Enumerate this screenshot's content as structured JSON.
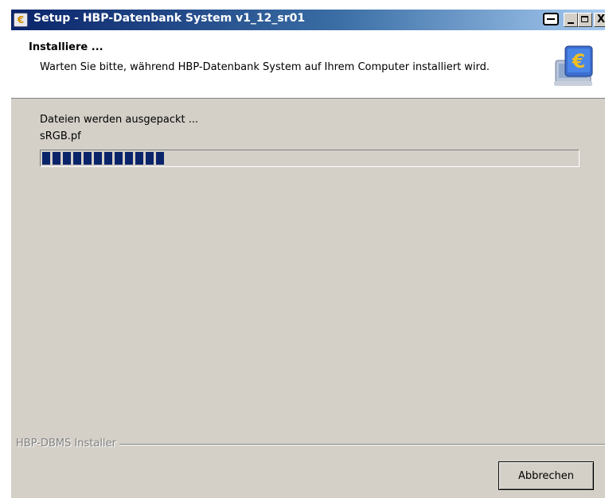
{
  "window": {
    "title": "Setup - HBP-Datenbank System v1_12_sr01",
    "icon": "setup-app-icon",
    "controls": [
      "system-menu-icon",
      "minimize-icon",
      "maximize-icon",
      "close-icon"
    ],
    "close_glyph": "X"
  },
  "header": {
    "title": "Installiere ...",
    "description": "Warten Sie bitte, während HBP-Datenbank System auf Ihrem Computer installiert wird.",
    "logo": "euro-computer-icon"
  },
  "body": {
    "status": "Dateien werden ausgepackt ...",
    "current_file": "sRGB.pf",
    "progress": 0.24
  },
  "footer": {
    "label": "HBP-DBMS Installer",
    "cancel_label": "Abbrechen"
  },
  "colors": {
    "title_gradient_start": "#0a246a",
    "title_gradient_end": "#a6caf0",
    "progress_fill": "#0a246a",
    "dialog_background": "#d4d0c8"
  }
}
